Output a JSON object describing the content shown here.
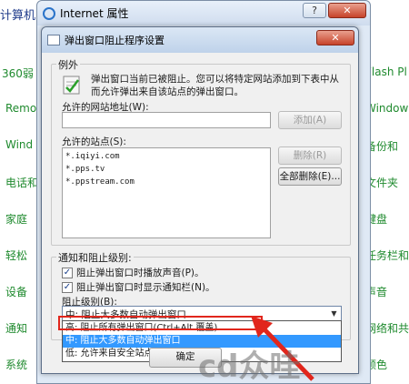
{
  "background_panel": {
    "title_fragment": "计算机ι",
    "left_items": [
      "360弱",
      "Remo",
      "Wind",
      "电话和",
      "家庭",
      "轻松",
      "设备",
      "通知",
      "系统"
    ],
    "right_items": [
      "Flash Pl",
      "Window",
      "备份和",
      "文件夹",
      "键盘",
      "任务栏和",
      "声音",
      "网络和共",
      "颜色"
    ]
  },
  "internet_properties": {
    "title": "Internet 属性",
    "help_btn": "?",
    "close_btn": "✕"
  },
  "popup_dialog": {
    "title": "弹出窗口阻止程序设置",
    "close_btn": "✕",
    "exceptions": {
      "legend": "例外",
      "description": "弹出窗口当前已被阻止。您可以将特定网站添加到下表中从而允许弹出来自该站点的弹出窗口。",
      "address_label": "允许的网站地址(W):",
      "address_value": "",
      "add_btn": "添加(A)",
      "allowed_label": "允许的站点(S):",
      "allowed_sites": [
        "*.iqiyi.com",
        "*.pps.tv",
        "*.ppstream.com"
      ],
      "remove_btn": "删除(R)",
      "remove_all_btn": "全部删除(E)..."
    },
    "notify": {
      "legend": "通知和阻止级别:",
      "sound_label": "阻止弹出窗口时播放声音(P)。",
      "sound_checked": true,
      "bar_label": "阻止弹出窗口时显示通知栏(N)。",
      "bar_checked": true,
      "level_label": "阻止级别(B):",
      "level_value": "中: 阻止大多数自动弹出窗口",
      "options": [
        "高: 阻止所有弹出窗口(Ctrl+Alt 覆盖)",
        "中: 阻止大多数自动弹出窗口",
        "低: 允许来自安全站点的弹出窗口"
      ],
      "selected_index": 1
    },
    "close_footer_btn": "确定"
  },
  "watermark": "cd众哇",
  "colors": {
    "highlight": "#3399ff",
    "annotation_red": "#e1261c",
    "link_green": "#1f8a2e"
  }
}
